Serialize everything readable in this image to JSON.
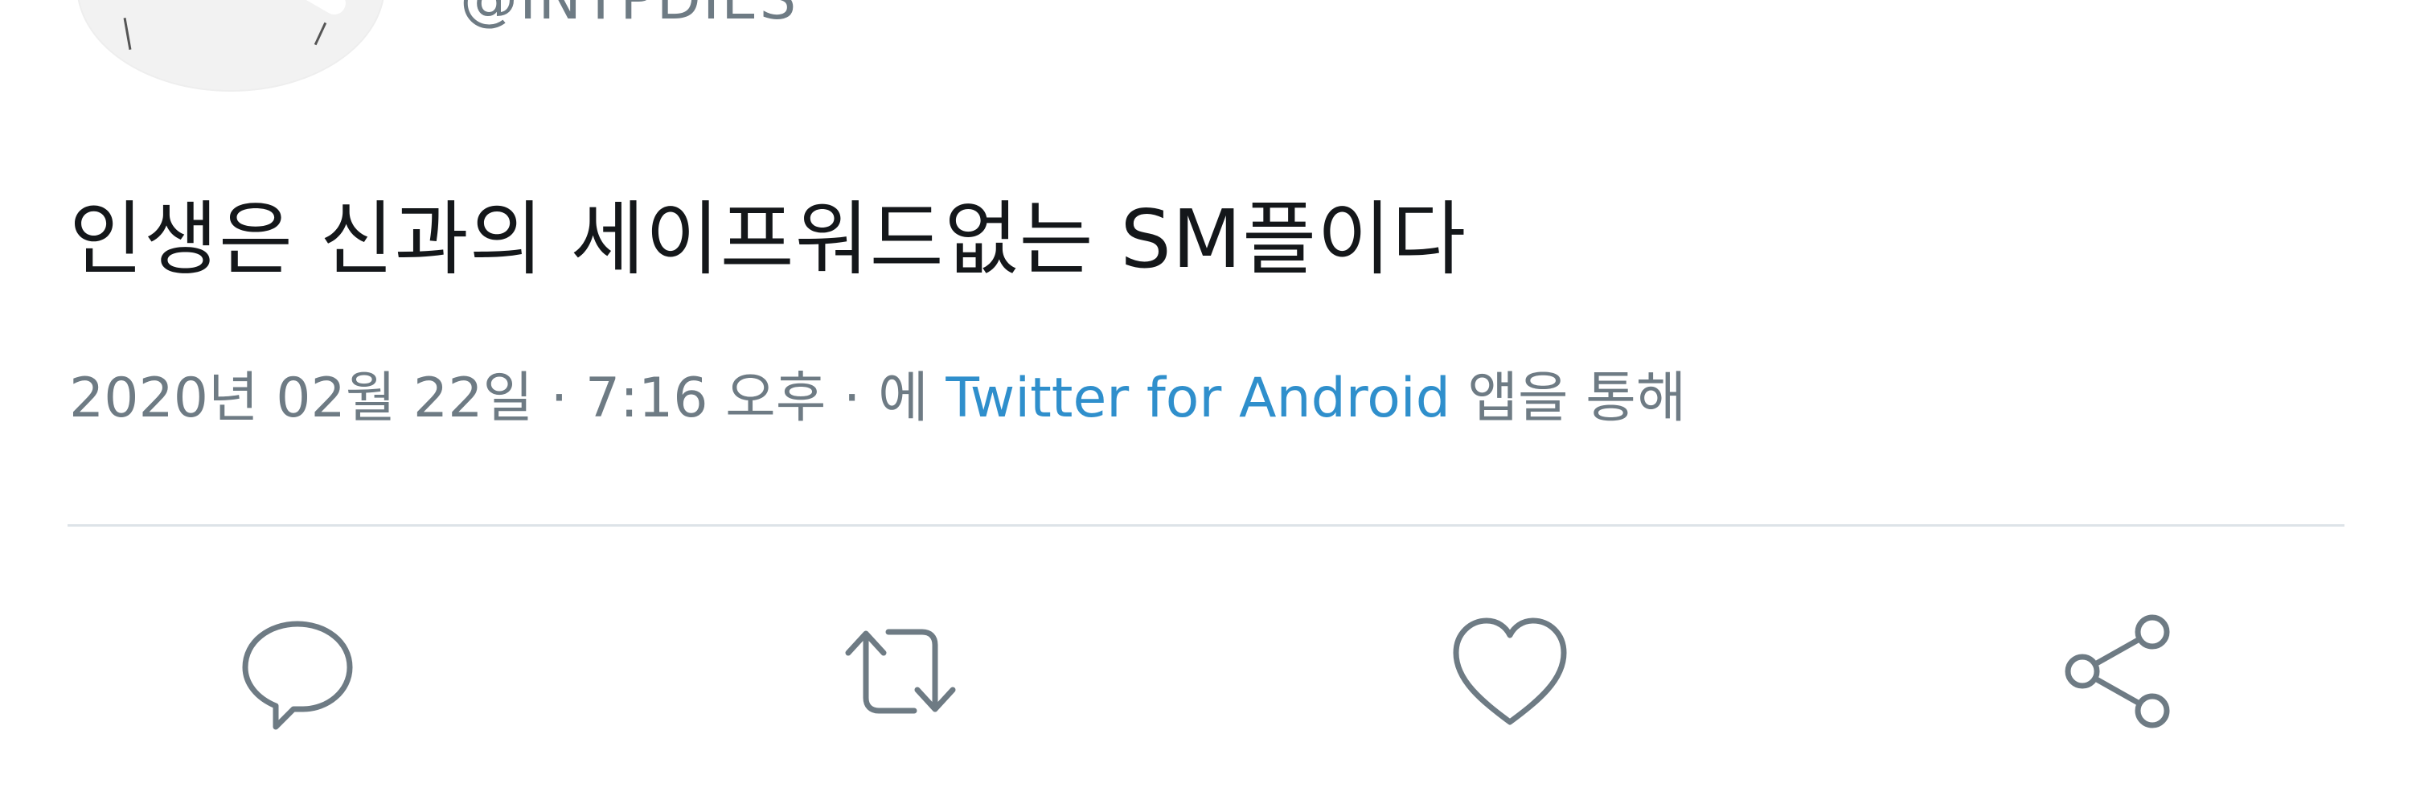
{
  "user": {
    "handle": "@INTPDIES"
  },
  "tweet": {
    "text": "인생은 신과의 세이프워드없는 SM플이다",
    "meta_prefix": "2020년 02월 22일 · 7:16 오후 · 에 ",
    "source": "Twitter for Android",
    "meta_suffix": " 앱을 통해"
  },
  "actions": {
    "reply": "reply-icon",
    "retweet": "retweet-icon",
    "like": "heart-icon",
    "share": "share-icon"
  },
  "colors": {
    "text": "#14171a",
    "secondary": "#6e7b84",
    "link": "#2f8fcc",
    "divider": "#dde3e8"
  }
}
